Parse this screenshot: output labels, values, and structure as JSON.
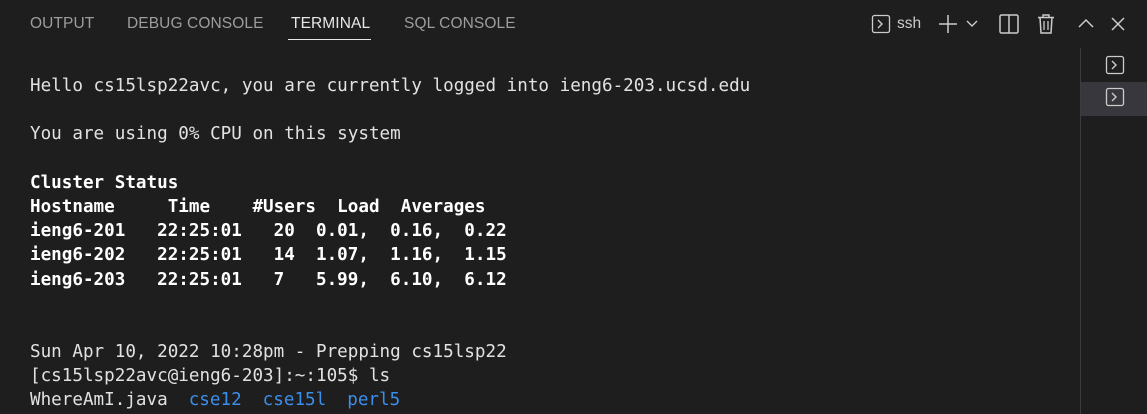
{
  "panel": {
    "tabs": [
      {
        "label": "OUTPUT"
      },
      {
        "label": "DEBUG CONSOLE"
      },
      {
        "label": "TERMINAL"
      },
      {
        "label": "SQL CONSOLE"
      }
    ],
    "active_tab": "TERMINAL",
    "actions": {
      "terminal_profile_label": "ssh",
      "icons": [
        "terminal-icon",
        "plus-icon",
        "chevron-down-icon",
        "split-icon",
        "trash-icon",
        "chevron-up-icon",
        "close-icon"
      ]
    }
  },
  "terminal": {
    "lines": [
      "Hello cs15lsp22avc, you are currently logged into ieng6-203.ucsd.edu",
      "",
      "You are using 0% CPU on this system",
      "",
      "Cluster Status",
      "Hostname     Time    #Users  Load  Averages",
      "ieng6-201   22:25:01   20  0.01,  0.16,  0.22",
      "ieng6-202   22:25:01   14  1.07,  1.16,  1.15",
      "ieng6-203   22:25:01   7   5.99,  6.10,  6.12",
      "",
      "",
      "Sun Apr 10, 2022 10:28pm - Prepping cs15lsp22",
      "[cs15lsp22avc@ieng6-203]:~:105$ ls"
    ],
    "ls_output": [
      {
        "name": "WhereAmI.java",
        "kind": "file"
      },
      {
        "name": "cse12",
        "kind": "dir"
      },
      {
        "name": "cse15l",
        "kind": "dir"
      },
      {
        "name": "perl5",
        "kind": "dir"
      }
    ],
    "colors": {
      "background": "#1e1e1e",
      "foreground": "#e2e2e2",
      "directory": "#3b8eea"
    }
  },
  "side_panel": {
    "items": [
      "terminal-instance-1",
      "terminal-instance-2"
    ],
    "selected_index": 1
  }
}
